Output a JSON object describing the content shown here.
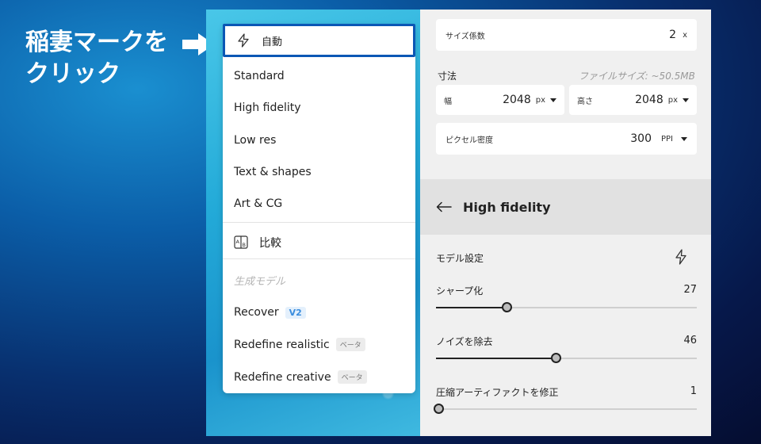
{
  "annotation": {
    "line1": "稲妻マークを",
    "line2": "クリック"
  },
  "menu": {
    "auto_label": "自動",
    "items": [
      "Standard",
      "High fidelity",
      "Low res",
      "Text & shapes",
      "Art & CG"
    ],
    "compare_label": "比較",
    "section_label": "生成モデル",
    "models": [
      {
        "label": "Recover",
        "tag": "V2"
      },
      {
        "label": "Redefine realistic",
        "tag": "ベータ"
      },
      {
        "label": "Redefine creative",
        "tag": "ベータ"
      }
    ]
  },
  "settings": {
    "scale_label": "サイズ係数",
    "scale_value": "2",
    "scale_unit": "x",
    "dimensions_label": "寸法",
    "file_size": "ファイルサイズ: ~50.5MB",
    "width_label": "幅",
    "width_value": "2048",
    "width_unit": "px",
    "height_label": "高さ",
    "height_value": "2048",
    "height_unit": "px",
    "density_label": "ピクセル密度",
    "density_value": "300",
    "density_unit": "PPI"
  },
  "model_panel": {
    "title": "High fidelity",
    "settings_label": "モデル設定",
    "sliders": [
      {
        "label": "シャープ化",
        "value": 27,
        "max": 100
      },
      {
        "label": "ノイズを除去",
        "value": 46,
        "max": 100
      },
      {
        "label": "圧縮アーティファクトを修正",
        "value": 1,
        "max": 100
      }
    ]
  }
}
